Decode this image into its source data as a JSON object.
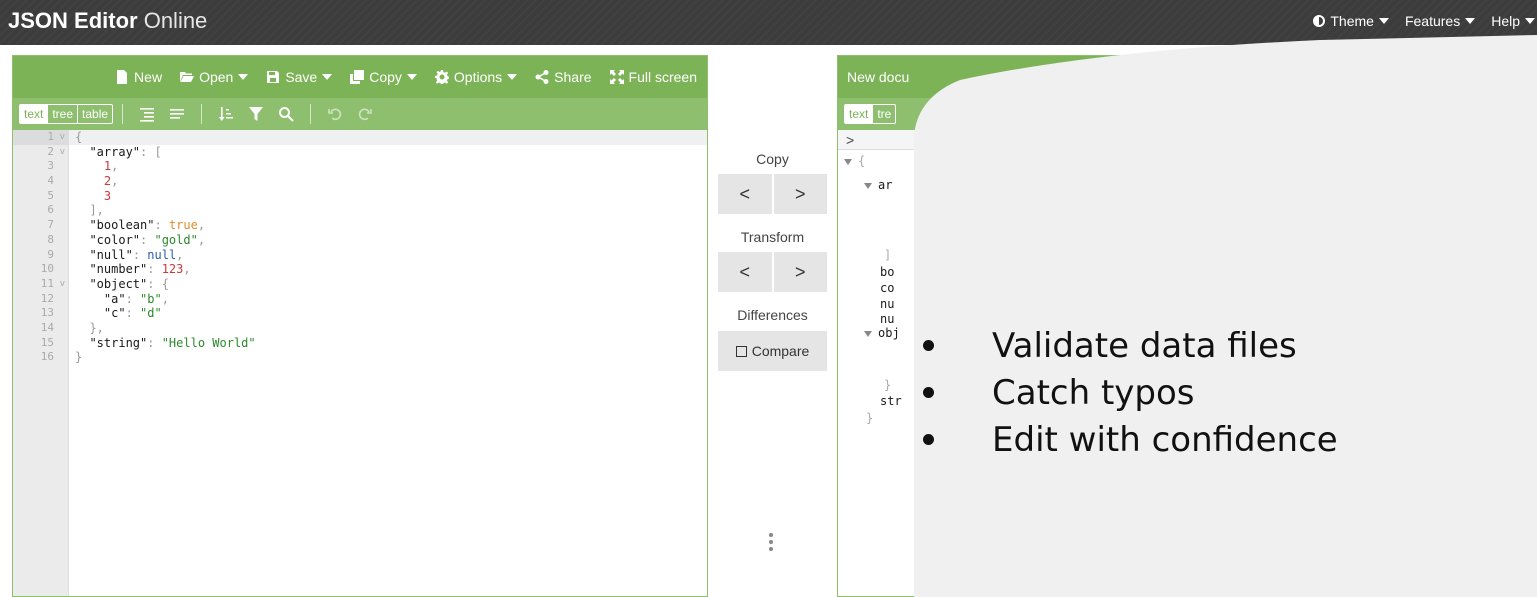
{
  "header": {
    "title_bold": "JSON Editor",
    "title_light": "Online",
    "menu": [
      {
        "label": "Theme",
        "icon": "theme-icon"
      },
      {
        "label": "Features"
      },
      {
        "label": "Help"
      }
    ]
  },
  "left_panel": {
    "menu": {
      "new": "New",
      "open": "Open",
      "save": "Save",
      "copy": "Copy",
      "options": "Options",
      "share": "Share",
      "fullscreen": "Full screen"
    },
    "modes": [
      "text",
      "tree",
      "table"
    ],
    "active_mode": "text",
    "line_numbers": [
      "1",
      "2",
      "3",
      "4",
      "5",
      "6",
      "7",
      "8",
      "9",
      "10",
      "11",
      "12",
      "13",
      "14",
      "15",
      "16"
    ]
  },
  "middle": {
    "copy_label": "Copy",
    "transform_label": "Transform",
    "differences_label": "Differences",
    "compare_label": "Compare",
    "arrow_left": "<",
    "arrow_right": ">"
  },
  "right_panel": {
    "title": "New docu",
    "mode_text": "text",
    "mode_tree": "tre",
    "nav_symbol": ">",
    "tree_lines": [
      "{",
      "ar",
      "]",
      "bo",
      "co",
      "nu",
      "nu",
      "obj",
      "}",
      "str",
      "}"
    ]
  },
  "overlay": {
    "bullets": [
      "Validate data files",
      "Catch typos",
      "Edit with confidence"
    ]
  },
  "colors": {
    "topbar": "#3c3c3c",
    "menu_green": "#7db357",
    "toolbar_green": "#8ebf6f",
    "overlay_bg": "#f0f0f0"
  }
}
